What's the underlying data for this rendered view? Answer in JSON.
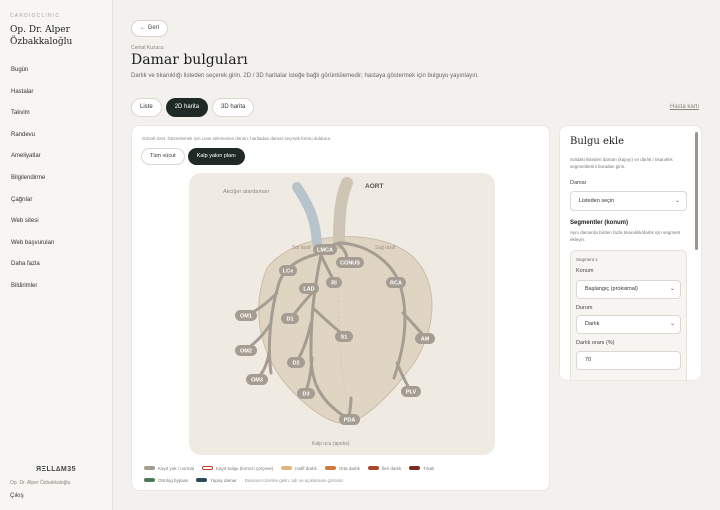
{
  "sidebar": {
    "brand_small": "CARDIOCLINIC",
    "doctor_name": "Op. Dr. Alper Özbakkaloğlu",
    "items": [
      {
        "label": "Bugün"
      },
      {
        "label": "Hastalar"
      },
      {
        "label": "Takvim"
      },
      {
        "label": "Randevu"
      },
      {
        "label": "Ameliyatlar"
      },
      {
        "label": "Bilgilendirme"
      },
      {
        "label": "Çağrılar"
      },
      {
        "label": "Web sitesi"
      },
      {
        "label": "Web başvuruları"
      },
      {
        "label": "Daha fazla"
      },
      {
        "label": "Bildirimler"
      }
    ],
    "logo_text": "ЯΞLL∆M35",
    "user": "Op. Dr. Alper Özbakkaloğlu",
    "logout": "Çıkış"
  },
  "header": {
    "back_label": "← Geri",
    "breadcrumb": "Cemal Kuzucu",
    "title": "Damar bulguları",
    "description": "Darlık ve tıkanıklığı listeden seçerek girin. 2D / 3D haritalar isteğe bağlı görüntülemedir; hastaya göstermek için bulguyu yayınlayın."
  },
  "tabs": [
    {
      "label": "Liste",
      "active": false
    },
    {
      "label": "2D harita",
      "active": true
    },
    {
      "label": "3D harita",
      "active": false
    }
  ],
  "patient_card_link": "Hasta kartı",
  "map": {
    "hint": "Görsel özet. Düzenlemek için Liste sekmesine dönün; haritadan damar seçmek formu doldurur.",
    "view_buttons": [
      {
        "label": "Tüm vücut",
        "active": false
      },
      {
        "label": "Kalp yakın planı",
        "active": true
      }
    ],
    "labels": {
      "lung_artery": "Akciğer atardamarı",
      "aorta": "AORT",
      "left_side": "Sol taraf",
      "right_side": "Sağ taraf",
      "apex": "Kalp ucu (apeks)"
    },
    "vessels": [
      "LMCA",
      "CONUS",
      "LCx",
      "LAD",
      "RI",
      "RCA",
      "OM1",
      "D1",
      "S1",
      "OM2",
      "D2",
      "AM",
      "OM3",
      "D3",
      "PLV",
      "PDA"
    ],
    "colors": {
      "normal": "#a69d92",
      "lung": "#b7c4cb",
      "aorta": "#cfc5b5",
      "heart": "#e0d5c3"
    }
  },
  "legend": {
    "items": [
      {
        "label": "Kayıt yok / normal",
        "color": "#a69d92",
        "outline": false
      },
      {
        "label": "Kayıt bulgu (kırmızı çerçeve)",
        "color": "#ffffff",
        "outline": true
      },
      {
        "label": "Hafif darlık",
        "color": "#e0b47f",
        "outline": false
      },
      {
        "label": "Orta darlık",
        "color": "#d07a3a",
        "outline": false
      },
      {
        "label": "İleri darlık",
        "color": "#a8482a",
        "outline": false
      },
      {
        "label": "Tıkalı",
        "color": "#7a2a20",
        "outline": false
      },
      {
        "label": "Ortolog bypass",
        "color": "#4e7a5e",
        "outline": false
      },
      {
        "label": "Yapay damar",
        "color": "#2a4a5a",
        "outline": false
      }
    ],
    "note": "Damarın üzerine gelin: adı ve açıklaması görünür."
  },
  "panel": {
    "title": "Bulgu ekle",
    "description": "Soldaki listeden damarı (kapıyı) ve darlık / tıkanıklık segmentlerini buradan girin.",
    "vessel_label": "Damar",
    "vessel_value": "Listeden seçin",
    "segments_title": "Segmentler (konum)",
    "segments_desc": "Aynı damarda birden fazla tıkanıklık/darlık için segment ekleyin.",
    "segment": {
      "title": "Segment 1",
      "location_label": "Konum",
      "location_value": "Başlangıç (proksimal)",
      "status_label": "Durum",
      "status_value": "Darlık",
      "percent_label": "Darlık oranı (%)",
      "percent_value": "70"
    }
  }
}
